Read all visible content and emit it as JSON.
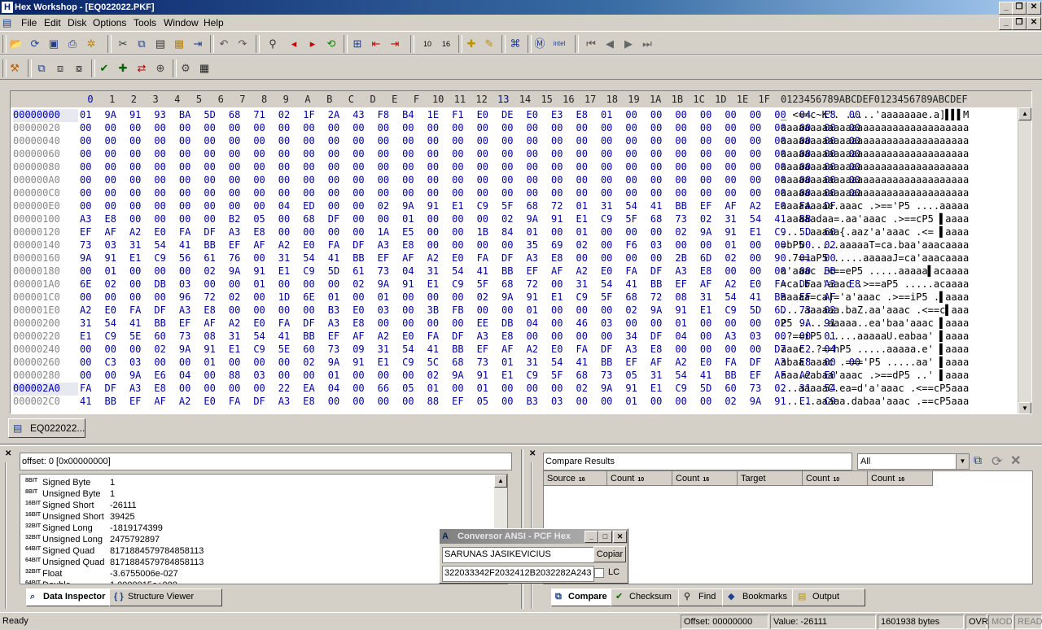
{
  "window": {
    "title": "Hex Workshop - [EQ022022.PKF]",
    "app_icon": "H"
  },
  "menu": [
    {
      "label": "File",
      "name": "file"
    },
    {
      "label": "Edit",
      "name": "edit"
    },
    {
      "label": "Disk",
      "name": "disk"
    },
    {
      "label": "Options",
      "name": "options"
    },
    {
      "label": "Tools",
      "name": "tools"
    },
    {
      "label": "Window",
      "name": "window"
    },
    {
      "label": "Help",
      "name": "help"
    }
  ],
  "hex": {
    "columns": [
      "0",
      "1",
      "2",
      "3",
      "4",
      "5",
      "6",
      "7",
      "8",
      "9",
      "A",
      "B",
      "C",
      "D",
      "E",
      "F",
      "10",
      "11",
      "12",
      "13",
      "14",
      "15",
      "16",
      "17",
      "18",
      "19",
      "1A",
      "1B",
      "1C",
      "1D",
      "1E",
      "1F"
    ],
    "ascii_header": "0123456789ABCDEF0123456789ABCDEF",
    "rows": [
      {
        "offset": "00000000",
        "bytes": "01 9A 91 93 BA 5D 68 71 02 1F 2A 43 F8 B4 1E F1 E0 DE E0 E3 E8 01 00 00 00 00 00 00 00 04 E8 00",
        "ascii": "_ <==c~K\". .....'aaaaaaae.a]▌▌▌M"
      },
      {
        "offset": "00000020",
        "bytes": "00 00 00 00 00 00 00 00 00 00 00 00 00 00 00 00 00 00 00 00 00 00 00 00 00 00 00 00 00 00 00 00",
        "ascii": "aaaaaaaaaaaaaaaaaaaaaaaaaaaaaaaa"
      },
      {
        "offset": "00000040",
        "bytes": "00 00 00 00 00 00 00 00 00 00 00 00 00 00 00 00 00 00 00 00 00 00 00 00 00 00 00 00 00 00 00 00",
        "ascii": "aaaaaaaaaaaaaaaaaaaaaaaaaaaaaaaa"
      },
      {
        "offset": "00000060",
        "bytes": "00 00 00 00 00 00 00 00 00 00 00 00 00 00 00 00 00 00 00 00 00 00 00 00 00 00 00 00 00 00 00 00",
        "ascii": "aaaaaaaaaaaaaaaaaaaaaaaaaaaaaaaa"
      },
      {
        "offset": "00000080",
        "bytes": "00 00 00 00 00 00 00 00 00 00 00 00 00 00 00 00 00 00 00 00 00 00 00 00 00 00 00 00 00 00 00 00",
        "ascii": "aaaaaaaaaaaaaaaaaaaaaaaaaaaaaaaa"
      },
      {
        "offset": "000000A0",
        "bytes": "00 00 00 00 00 00 00 00 00 00 00 00 00 00 00 00 00 00 00 00 00 00 00 00 00 00 00 00 00 00 00 00",
        "ascii": "aaaaaaaaaaaaaaaaaaaaaaaaaaaaaaaa"
      },
      {
        "offset": "000000C0",
        "bytes": "00 00 00 00 00 00 00 00 00 00 00 00 00 00 00 00 00 00 00 00 00 00 00 00 00 00 00 00 00 00 00 00",
        "ascii": "aaaaaaaaaaaaaaaaaaaaaaaaaaaaaaaa"
      },
      {
        "offset": "000000E0",
        "bytes": "00 00 00 00 00 00 00 00 04 ED 00 00 02 9A 91 E1 C9 5F 68 72 01 31 54 41 BB EF AF A2 E0 FA DF",
        "ascii": "aaaaaaaae.aaac .>=='P5 ....aaaaa"
      },
      {
        "offset": "00000100",
        "bytes": "A3 E8 00 00 00 00 B2 05 00 68 DF 00 00 01 00 00 00 02 9A 91 E1 C9 5F 68 73 02 31 54 41 BB",
        "ascii": ".aaaaadaa=.aa'aaac .>==cP5 ▌aaaa"
      },
      {
        "offset": "00000120",
        "bytes": "EF AF A2 E0 FA DF A3 E8 00 00 00 00 1A E5 00 00 1B 84 01 00 01 00 00 00 02 9A 91 E1 C9 5D 60",
        "ascii": ".....aaaaa{.aaz'a'aaac .<= ▌aaaa"
      },
      {
        "offset": "00000140",
        "bytes": "73 03 31 54 41 BB EF AF A2 E0 FA DF A3 E8 00 00 00 00 35 69 02 00 F6 03 00 00 01 00 00 00 02",
        "ascii": "=bP5 .....aaaaaT=ca.baa'aaacaaaa"
      },
      {
        "offset": "00000160",
        "bytes": "9A 91 E1 C9 56 61 76 00 31 54 41 BB EF AF A2 E0 FA DF A3 E8 00 00 00 00 2B 6D 02 00 90 01 00",
        "ascii": " .7==aP5 .....aaaaaJ=ca'aaacaaaa"
      },
      {
        "offset": "00000180",
        "bytes": "00 01 00 00 00 02 9A 91 E1 C9 5D 61 73 04 31 54 41 BB EF AF A2 E0 FA DF A3 E8 00 00 00 00 BB",
        "ascii": "a'aaac .<==eP5 .....aaaaa▌acaaaa"
      },
      {
        "offset": "000001A0",
        "bytes": "6E 02 00 DB 03 00 00 01 00 00 00 02 9A 91 E1 C9 5F 68 72 00 31 54 41 BB EF AF A2 E0 FA DF A3 E8",
        "ascii": "=ca.baa'aaac .>==aP5 .....acaaaa"
      },
      {
        "offset": "000001C0",
        "bytes": "00 00 00 00 96 72 02 00 1D 6E 01 00 01 00 00 00 02 9A 91 E1 C9 5F 68 72 08 31 54 41 BB EF AF",
        "ascii": "aaaaa=ca|='a'aaac .>==iP5 .▌aaaa"
      },
      {
        "offset": "000001E0",
        "bytes": "A2 E0 FA DF A3 E8 00 00 00 00 B3 E0 03 00 3B FB 00 00 01 00 00 00 02 9A 91 E1 C9 5D 6D 73 02",
        "ascii": "....aaaaaa.baZ.aa'aaac .<==c▌aaa"
      },
      {
        "offset": "00000200",
        "bytes": "31 54 41 BB EF AF A2 E0 FA DF A3 E8 00 00 00 00 EE DB 04 00 46 03 00 00 01 00 00 00 02 9A 91",
        "ascii": "P5 .....aaaaa..ea'baa'aaac ▌aaaa"
      },
      {
        "offset": "00000220",
        "bytes": "E1 C9 5E 60 73 08 31 54 41 BB EF AF A2 E0 FA DF A3 E8 00 00 00 00 34 DF 04 00 A3 03 00 00 01",
        "ascii": ".?==iP5 .....aaaaaU.eabaa' ▌aaaa"
      },
      {
        "offset": "00000240",
        "bytes": "00 00 00 02 9A 91 E1 C9 5E 60 73 09 31 54 41 BB EF AF A2 E0 FA DF A3 E8 00 00 00 00 D7 E2 04",
        "ascii": "aaac .?==hP5 .....aaaaa.e' ▌aaaa"
      },
      {
        "offset": "00000260",
        "bytes": "00 C3 03 00 00 01 00 00 00 02 9A 91 E1 C9 5C 68 73 01 31 54 41 BB EF AF A2 E0 FA DF A3 E8 00 00",
        "ascii": "abaa'aaac .==='P5 .....aa' ▌aaaa"
      },
      {
        "offset": "00000280",
        "bytes": "00 00 9A E6 04 00 88 03 00 00 01 00 00 00 02 9A 91 E1 C9 5F 68 73 05 31 54 41 BB EF AF A2 E0",
        "ascii": "aaa.eabaa'aaac .>==dP5 ..' ▌aaaa"
      },
      {
        "offset": "000002A0",
        "bytes": "FA DF A3 E8 00 00 00 00 22 EA 04 00 66 05 01 00 01 00 00 00 02 9A 91 E1 C9 5D 60 73 02 31 54",
        "ascii": "...aaaaaC.ea=d'a'aaac .<==cP5aaa"
      },
      {
        "offset": "000002C0",
        "bytes": "41 BB EF AF A2 E0 FA DF A3 E8 00 00 00 00 88 EF 05 00 B3 03 00 00 01 00 00 00 02 9A 91 E1 C9",
        "ascii": " .....aaaaa.dabaa'aaac .==cP5aaa"
      }
    ]
  },
  "doc_tab": {
    "label": "EQ022022..."
  },
  "inspector": {
    "offset_label": "offset: 0 [0x00000000]",
    "rows": [
      {
        "bits": "8BIT",
        "label": "Signed Byte",
        "value": "1"
      },
      {
        "bits": "8BIT",
        "label": "Unsigned Byte",
        "value": "1"
      },
      {
        "bits": "16BIT",
        "label": "Signed Short",
        "value": "-26111"
      },
      {
        "bits": "16BIT",
        "label": "Unsigned Short",
        "value": "39425"
      },
      {
        "bits": "32BIT",
        "label": "Signed Long",
        "value": "-1819174399"
      },
      {
        "bits": "32BIT",
        "label": "Unsigned Long",
        "value": "2475792897"
      },
      {
        "bits": "64BIT",
        "label": "Signed Quad",
        "value": "8171884579784858113"
      },
      {
        "bits": "64BIT",
        "label": "Unsigned Quad",
        "value": "8171884579784858113"
      },
      {
        "bits": "32BIT",
        "label": "Float",
        "value": "-3.6755006e-027"
      },
      {
        "bits": "64BIT",
        "label": "Double",
        "value": "1.0000015e+000"
      }
    ],
    "tabs": [
      {
        "label": "Data Inspector",
        "name": "data-inspector",
        "selected": true
      },
      {
        "label": "Structure Viewer",
        "name": "structure-viewer",
        "selected": false
      }
    ]
  },
  "compare": {
    "title": "Compare Results",
    "filter": "All",
    "columns": [
      {
        "label": "Source",
        "bits": "16"
      },
      {
        "label": "Count",
        "bits": "10"
      },
      {
        "label": "Count",
        "bits": "16"
      },
      {
        "label": "Target",
        "bits": ""
      },
      {
        "label": "Count",
        "bits": "10"
      },
      {
        "label": "Count",
        "bits": "16"
      }
    ],
    "tabs": [
      {
        "label": "Compare",
        "name": "compare",
        "selected": true
      },
      {
        "label": "Checksum",
        "name": "checksum",
        "selected": false
      },
      {
        "label": "Find",
        "name": "find",
        "selected": false
      },
      {
        "label": "Bookmarks",
        "name": "bookmarks",
        "selected": false
      },
      {
        "label": "Output",
        "name": "output",
        "selected": false
      }
    ]
  },
  "dialog": {
    "title": "Conversor ANSI - PCF Hex",
    "input": "SARUNAS JASIKEVICIUS",
    "copy_button": "Copiar",
    "output": "322033342F2032412B2032282A243",
    "lc_label": "LC"
  },
  "status": {
    "ready": "Ready",
    "offset": "Offset: 00000000",
    "value": "Value: -26111",
    "size": "1601938 bytes",
    "ovr": "OVR",
    "mod": "MOD",
    "read": "READ"
  },
  "colors": {
    "title_start": "#0a246a",
    "title_end": "#a6caf0",
    "hex_byte": "#0000a0",
    "face": "#d4d0c8"
  }
}
